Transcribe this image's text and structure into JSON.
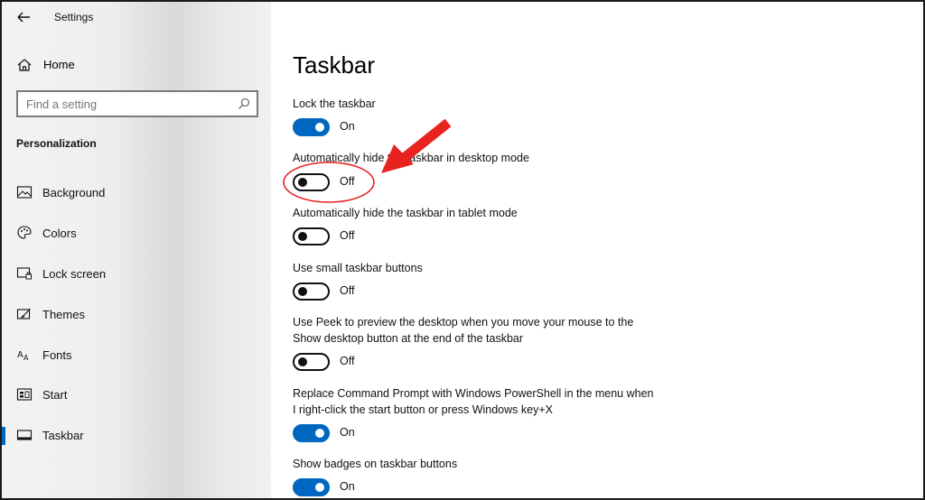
{
  "app": {
    "title": "Settings"
  },
  "sidebar": {
    "home_label": "Home",
    "search_placeholder": "Find a setting",
    "section_label": "Personalization",
    "items": [
      {
        "label": "Background",
        "icon": "image-icon"
      },
      {
        "label": "Colors",
        "icon": "palette-icon"
      },
      {
        "label": "Lock screen",
        "icon": "lock-screen-icon"
      },
      {
        "label": "Themes",
        "icon": "themes-icon"
      },
      {
        "label": "Fonts",
        "icon": "fonts-icon"
      },
      {
        "label": "Start",
        "icon": "start-icon"
      },
      {
        "label": "Taskbar",
        "icon": "taskbar-icon",
        "selected": true
      }
    ]
  },
  "main": {
    "title": "Taskbar",
    "settings": [
      {
        "label": "Lock the taskbar",
        "state": "On",
        "on": true
      },
      {
        "label": "Automatically hide the taskbar in desktop mode",
        "state": "Off",
        "on": false
      },
      {
        "label": "Automatically hide the taskbar in tablet mode",
        "state": "Off",
        "on": false
      },
      {
        "label": "Use small taskbar buttons",
        "state": "Off",
        "on": false
      },
      {
        "label": "Use Peek to preview the desktop when you move your mouse to the Show desktop button at the end of the taskbar",
        "state": "Off",
        "on": false
      },
      {
        "label": "Replace Command Prompt with Windows PowerShell in the menu when I right-click the start button or press Windows key+X",
        "state": "On",
        "on": true
      },
      {
        "label": "Show badges on taskbar buttons",
        "state": "On",
        "on": true
      }
    ]
  },
  "colors": {
    "accent": "#0067c0",
    "annotation": "#e8231f"
  }
}
